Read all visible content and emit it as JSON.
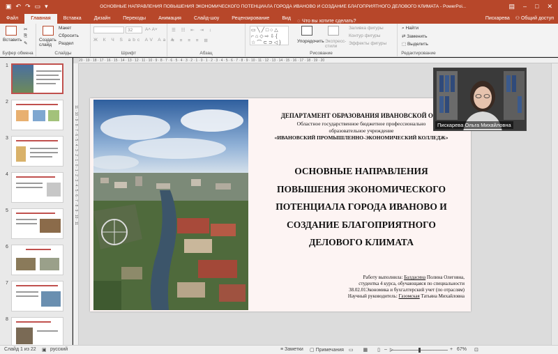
{
  "window": {
    "title": "ОСНОВНЫЕ НАПРАВЛЕНИЯ ПОВЫШЕНИЯ ЭКОНОМИЧЕСКОГО ПОТЕНЦИАЛА ГОРОДА ИВАНОВО И СОЗДАНИЕ БЛАГОПРИЯТНОГО ДЕЛОВОГО КЛИМАТА - PowerPoi...",
    "user": "Пискарева",
    "share": "Общий доступ"
  },
  "tabs": [
    "Файл",
    "Главная",
    "Вставка",
    "Дизайн",
    "Переходы",
    "Анимация",
    "Слайд-шоу",
    "Рецензирование",
    "Вид"
  ],
  "tell_me": "Что вы хотите сделать?",
  "ribbon": {
    "clipboard": {
      "paste": "Вставить",
      "label": "Буфер обмена"
    },
    "slides": {
      "new_slide": "Создать слайд",
      "layout": "Макет",
      "reset": "Сбросить",
      "section": "Раздел",
      "label": "Слайды"
    },
    "font": {
      "size": "32",
      "label": "Шрифт"
    },
    "paragraph": {
      "label": "Абзац"
    },
    "drawing": {
      "arrange": "Упорядочить",
      "quick_styles": "Экспресс-стили",
      "fill": "Заливка фигуры",
      "outline": "Контур фигуры",
      "effects": "Эффекты фигуры",
      "label": "Рисование"
    },
    "editing": {
      "find": "Найти",
      "replace": "Заменить",
      "select": "Выделить",
      "label": "Редактирование"
    }
  },
  "thumbnails": [
    "1",
    "2",
    "3",
    "4",
    "5",
    "6",
    "7",
    "8"
  ],
  "ruler": "20 · 19 · 18 · 17 · 16 · 15 · 14 · 13 · 12 · 11 · 10 · 9 · 8 · 7 · 6 · 5 · 4 · 3 · 2 · 1 · 0 · 1 · 2 · 3 · 4 · 5 · 6 · 7 · 8 · 9 · 10 · 11 · 12 · 13 · 14 · 15 · 16 · 17 · 18 · 19 · 20",
  "vruler": "11 · 10 · 9 · 8 · 7 · 6 · 5 · 4 · 3 · 2 · 1 · 0 · 1 · 2 · 3 · 4 · 5 · 6 · 7 · 8 · 9 · 10 · 11",
  "slide": {
    "org_line1": "ДЕПАРТАМЕНТ ОБРАЗОВАНИЯ ИВАНОВСКОЙ ОБЛ",
    "org_line2": "Областное государственное бюджетное профессионально",
    "org_line3": "образовательное учреждение",
    "org_line4": "«ИВАНОВСКИЙ ПРОМЫШЛЕННО-ЭКОНОМИЧЕСКИЙ КОЛЛЕДЖ»",
    "title_lines": [
      "ОСНОВНЫЕ НАПРАВЛЕНИЯ",
      "ПОВЫШЕНИЯ ЭКОНОМИЧЕСКОГО",
      "ПОТЕНЦИАЛА ГОРОДА ИВАНОВО И",
      "СОЗДАНИЕ БЛАГОПРИЯТНОГО",
      "ДЕЛОВОГО КЛИМАТА"
    ],
    "author_prefix": "Работу выполнила:",
    "author_surname": "Балдасина",
    "author_name": "Полина Олеговна,",
    "author_line2": "студентка 4 курса, обучающаяся по специальности",
    "author_line3": "38.02.01Экономика и бухгалтерский учет (по отраслям)",
    "supervisor_prefix": "Научный руководитель:",
    "supervisor_surname": "Газомская",
    "supervisor_name": "Татьяна Михайловна"
  },
  "video": {
    "name": "Пискарева Ольга Михайловна"
  },
  "status": {
    "slide": "Слайд 1 из 22",
    "lang": "русский",
    "notes": "Заметки",
    "comments": "Примечания",
    "zoom": "67%",
    "zoom_level": 0.5
  },
  "colors": {
    "accent": "#b7472a",
    "selection": "#c0504d"
  }
}
